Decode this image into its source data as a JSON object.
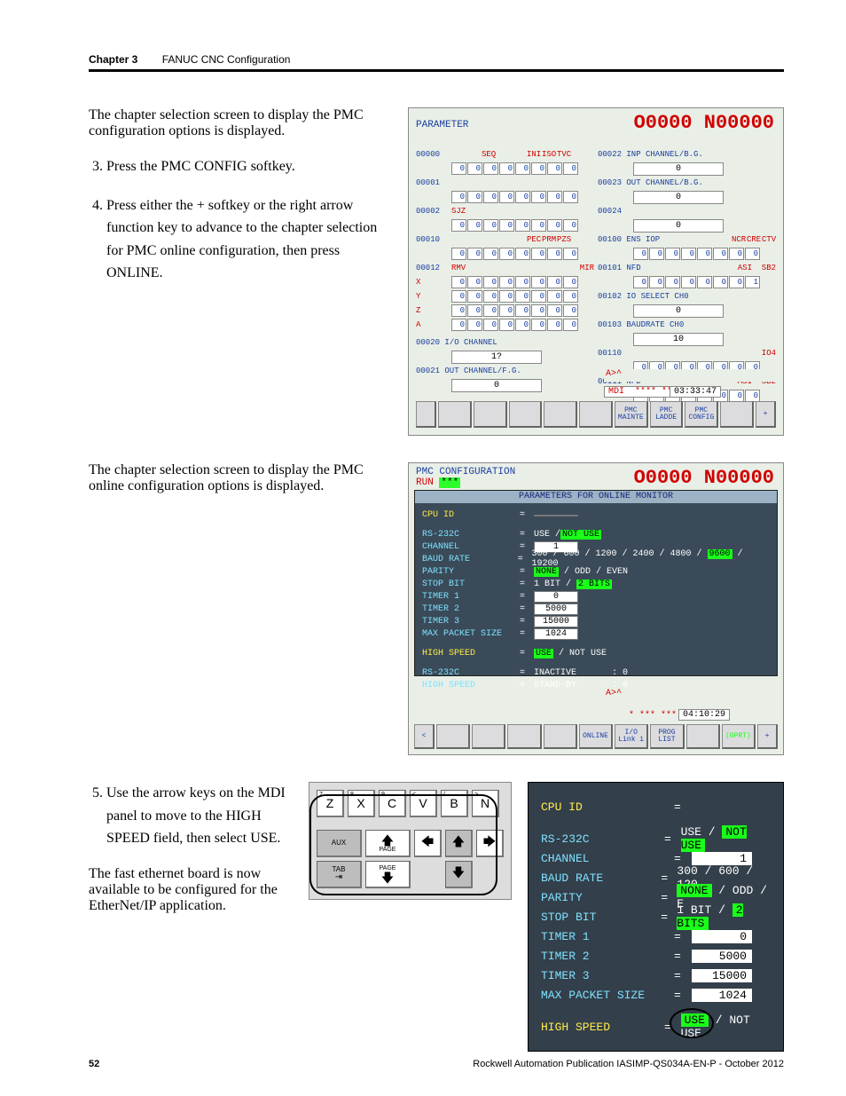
{
  "header": {
    "chapter": "Chapter 3",
    "title": "FANUC CNC Configuration"
  },
  "para1": "The chapter selection screen to display the PMC configuration options is displayed.",
  "step3": {
    "n": "3.",
    "t": "Press the PMC CONFIG softkey."
  },
  "step4": {
    "n": "4.",
    "t": "Press either the + softkey or the right arrow function key to advance to the chapter selection for PMC online configuration, then press ONLINE."
  },
  "para2": "The chapter selection screen to display the PMC online configuration options is displayed.",
  "step5": {
    "n": "5.",
    "t": "Use the arrow keys on the MDI panel to move to the HIGH SPEED field, then select USE."
  },
  "para3": "The fast ethernet board is now available to be configured for the EtherNet/IP application.",
  "s1": {
    "param": "PARAMETER",
    "onum": "O0000 N00000",
    "left_headers": [
      "SEQ",
      "",
      "INI",
      "ISO",
      "TVC"
    ],
    "right_headers": [
      "NCR",
      "CRE",
      "CTV"
    ],
    "rows_left": [
      "00000",
      "00001",
      "00002",
      "00010",
      "00012",
      "X",
      "Y",
      "Z",
      "A"
    ],
    "lab_sjz": "SJZ",
    "lab_rmv": "RMV",
    "lab_mir": "MIR",
    "lab_pec": "PEC",
    "lab_prm": "PRM",
    "lab_pzs": "PZS",
    "r00020": "00020 I/O CHANNEL",
    "r00020v": "1?",
    "r00021": "00021 OUT CHANNEL/F.G.",
    "r00021v": "0",
    "rows_right": [
      "00022 INP CHANNEL/B.G.",
      "00023 OUT CHANNEL/B.G.",
      "00024"
    ],
    "r00100": "00100 ENS IOP",
    "r00101": "00101 NFD",
    "r00101b": "ASI",
    "r00101c": "SB2",
    "r00102": "00102 IO SELECT CH0",
    "r00102v": "0",
    "r00103": "00103 BAUDRATE CH0",
    "r00103v": "10",
    "r00110": "00110",
    "r00110b": "IO4",
    "r00111": "00111 NFD",
    "r00111b": "ASI",
    "r00111c": "SB2",
    "hat": "A>^",
    "mdi": "MDI",
    "mdi_stars": "**** ***",
    "time": "03:33:47",
    "sk": [
      "",
      "",
      "",
      "",
      "",
      "",
      "PMC MAINTE",
      "PMC LADDE",
      "PMC CONFIG",
      "",
      "",
      "+"
    ]
  },
  "s2": {
    "hdr": "PMC CONFIGURATION",
    "run": "RUN",
    "onum": "O0000 N00000",
    "title": "PARAMETERS FOR ONLINE MONITOR",
    "lines": [
      {
        "l": "CPU ID",
        "y": true,
        "v": "",
        "box": true
      },
      {
        "gap": true
      },
      {
        "l": "RS-232C",
        "v": "USE  /",
        "hi": "NOT USE"
      },
      {
        "l": "CHANNEL",
        "v": "",
        "box": true,
        "boxv": "1"
      },
      {
        "l": "BAUD RATE",
        "v": "300 / 600 / 1200 / 2400 / 4800 / ",
        "hi": "9600",
        "tail": " / 19200"
      },
      {
        "l": "PARITY",
        "v": "",
        "hi": "NONE",
        "tail": " / ODD  / EVEN"
      },
      {
        "l": "STOP BIT",
        "v": "1 BIT / ",
        "hi": "2 BITS"
      },
      {
        "l": "TIMER 1",
        "v": "",
        "box": true,
        "boxv": "0"
      },
      {
        "l": "TIMER 2",
        "v": "",
        "box": true,
        "boxv": "5000"
      },
      {
        "l": "TIMER 3",
        "v": "",
        "box": true,
        "boxv": "15000"
      },
      {
        "l": "MAX PACKET SIZE",
        "eqshift": true,
        "v": "",
        "box": true,
        "boxv": "1024"
      },
      {
        "gap": true
      },
      {
        "l": "HIGH SPEED",
        "y": true,
        "v": "",
        "hi": "USE",
        "tail": " / NOT USE"
      },
      {
        "gap": true
      },
      {
        "l": "RS-232C",
        "v": "INACTIVE",
        "stat": ": 0"
      },
      {
        "l": "HIGH SPEED",
        "v": "STAND-BY",
        "stat": ": 0"
      }
    ],
    "hat": "A>^",
    "time": "04:10:29",
    "stars": "* *** ***",
    "sk": [
      "<",
      "",
      "",
      "",
      "",
      "ONLINE",
      "I/O Link i",
      "PROG LIST",
      "",
      "(OPRT)",
      "+"
    ]
  },
  "keypad": {
    "r1": [
      {
        "s": "7",
        "t": "Z"
      },
      {
        "s": "8",
        "t": "X"
      },
      {
        "s": "9",
        "t": "C"
      },
      {
        "s": "<",
        "t": "V"
      },
      {
        "s": "/",
        "t": "B"
      },
      {
        "s": ">",
        "t": "N"
      }
    ],
    "aux": "AUX",
    "pageu": "PAGE",
    "paged": "PAGE",
    "tab": "TAB"
  },
  "detail": {
    "lines": [
      {
        "l": "CPU ID",
        "y": true,
        "box": true,
        "boxv": ""
      },
      {
        "gap": true
      },
      {
        "l": "RS-232C",
        "v": "USE  / ",
        "hi": "NOT USE"
      },
      {
        "l": "CHANNEL",
        "box": true,
        "boxv": "1"
      },
      {
        "l": "BAUD RATE",
        "v": "300 / 600 / 120"
      },
      {
        "l": "PARITY",
        "hi": "NONE",
        "tail": " / ODD  / E"
      },
      {
        "l": "STOP BIT",
        "v": "1 BIT / ",
        "hi": "2 BITS"
      },
      {
        "l": "TIMER 1",
        "box": true,
        "boxv": "0"
      },
      {
        "l": "TIMER 2",
        "box": true,
        "boxv": "5000"
      },
      {
        "l": "TIMER 3",
        "box": true,
        "boxv": "15000"
      },
      {
        "l": "MAX PACKET SIZE",
        "eqshift": true,
        "box": true,
        "boxv": "1024"
      },
      {
        "gap": true
      },
      {
        "l": "HIGH SPEED",
        "y": true,
        "hi": "USE",
        "tail": " / NOT USE",
        "circle": true
      }
    ]
  },
  "footer": {
    "pg": "52",
    "pub": "Rockwell Automation Publication IASIMP-QS034A-EN-P - October 2012"
  }
}
